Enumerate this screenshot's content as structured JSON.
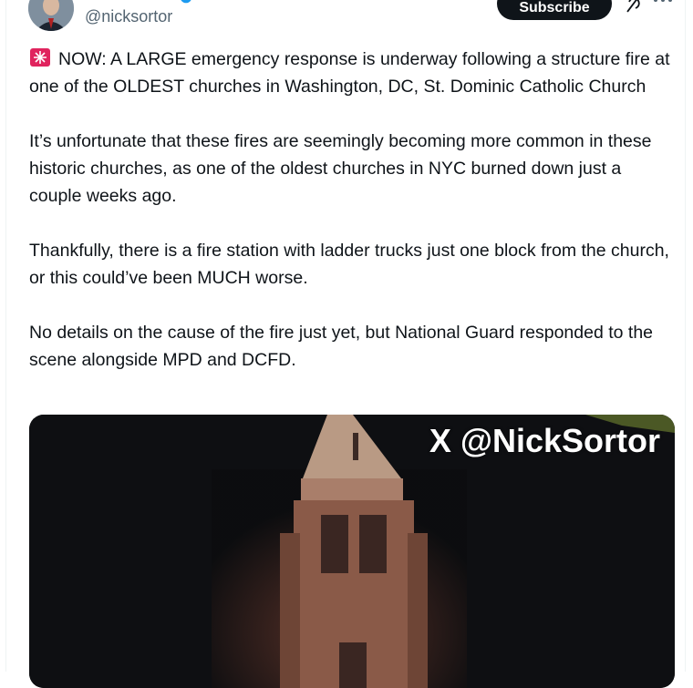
{
  "author": {
    "handle": "@nicksortor",
    "verified_color": "#1d9bf0"
  },
  "header": {
    "subscribe_label": "Subscribe",
    "grok_icon": "grok-icon",
    "more_icon": "more-horizontal-icon"
  },
  "tweet": {
    "paragraph_1": "NOW: A LARGE emergency response is underway following a structure fire at one of the OLDEST churches in Washington, DC, St. Dominic Catholic Church",
    "paragraph_2": "It’s unfortunate that these fires are seemingly becoming more common in these historic churches, as one of the oldest churches in NYC burned down just a couple weeks ago.",
    "paragraph_3": "Thankfully, there is a fire station with ladder trucks just one block from the church, or this could’ve been MUCH worse.",
    "paragraph_4": "No details on the cause of the fire just yet, but National Guard responded to the scene alongside MPD and DCFD.",
    "siren_icon": "police-siren-emoji"
  },
  "media": {
    "watermark": "X @NickSortor",
    "description_icon": "church-steeple-night-image"
  }
}
